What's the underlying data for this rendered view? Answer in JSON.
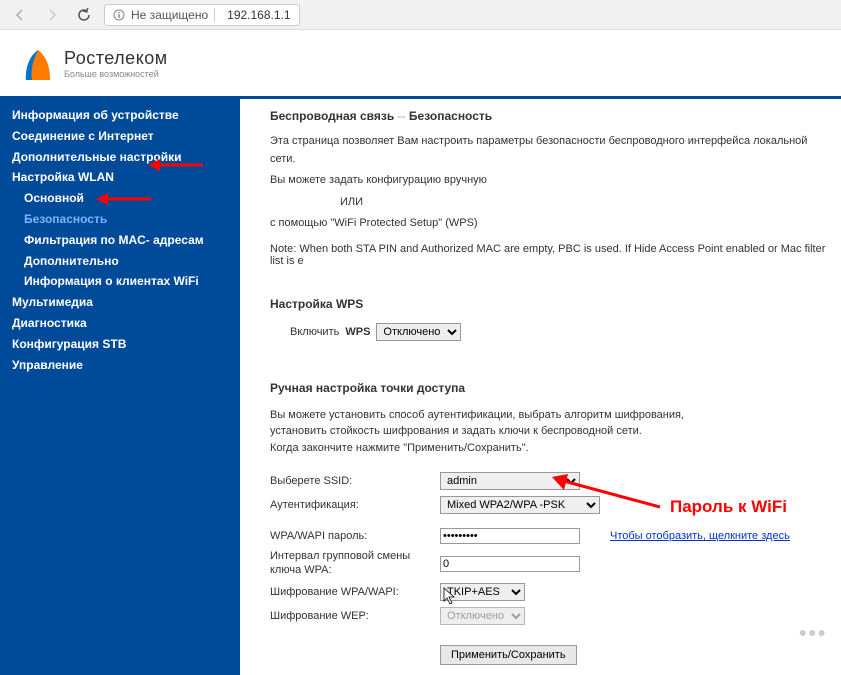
{
  "browser": {
    "security_label": "Не защищено",
    "url": "192.168.1.1"
  },
  "brand": {
    "name": "Ростелеком",
    "tagline": "Больше возможностей"
  },
  "sidebar": {
    "items": [
      {
        "label": "Информация об устройстве",
        "sub": false
      },
      {
        "label": "Соединение с Интернет",
        "sub": false
      },
      {
        "label": "Дополнительные настройки",
        "sub": false
      },
      {
        "label": "Настройка WLAN",
        "sub": false
      },
      {
        "label": "Основной",
        "sub": true
      },
      {
        "label": "Безопасность",
        "sub": true,
        "active": true
      },
      {
        "label": "Фильтрация по MAC- адресам",
        "sub": true
      },
      {
        "label": "Дополнительно",
        "sub": true
      },
      {
        "label": "Информация о клиентах WiFi",
        "sub": true
      },
      {
        "label": "Мультимедиа",
        "sub": false
      },
      {
        "label": "Диагностика",
        "sub": false
      },
      {
        "label": "Конфигурация STB",
        "sub": false
      },
      {
        "label": "Управление",
        "sub": false
      }
    ]
  },
  "main": {
    "breadcrumb_1": "Беспроводная связь",
    "breadcrumb_sep": "--",
    "breadcrumb_2": "Безопасность",
    "desc_1": "Эта страница позволяет Вам настроить параметры безопасности беспроводного интерфейса локальной сети.",
    "desc_2": "Вы можете задать конфигурацию вручную",
    "desc_3": "ИЛИ",
    "desc_4": "с помощью \"WiFi Protected Setup\" (WPS)",
    "note": "Note: When both STA PIN and Authorized MAC are empty, PBC is used. If Hide Access Point enabled or Mac filter list is e",
    "wps_title": "Настройка WPS",
    "wps_label_1": "Включить",
    "wps_label_2": "WPS",
    "wps_value": "Отключено",
    "ap_title": "Ручная настройка точки доступа",
    "ap_desc_1": "Вы можете установить способ аутентификации, выбрать алгоритм шифрования,",
    "ap_desc_2": "установить стойкость шифрования и задать ключи к беспроводной сети.",
    "ap_desc_3": "Когда закончите нажмите \"Применить/Сохранить\".",
    "form": {
      "ssid_label": "Выберете SSID:",
      "ssid_value": "admin",
      "auth_label": "Аутентификация:",
      "auth_value": "Mixed WPA2/WPA -PSK",
      "pwd_label": "WPA/WAPI пароль:",
      "pwd_value": "•••••••••",
      "show_link": "Чтобы отобразить, щелкните здесь",
      "interval_label": "Интервал групповой смены ключа WPA:",
      "interval_value": "0",
      "enc_label": "Шифрование WPA/WAPI:",
      "enc_value": "TKIP+AES",
      "wep_label": "Шифрование WEP:",
      "wep_value": "Отключено"
    },
    "apply_btn": "Применить/Сохранить"
  },
  "annotation": {
    "text": "Пароль к WiFi"
  }
}
